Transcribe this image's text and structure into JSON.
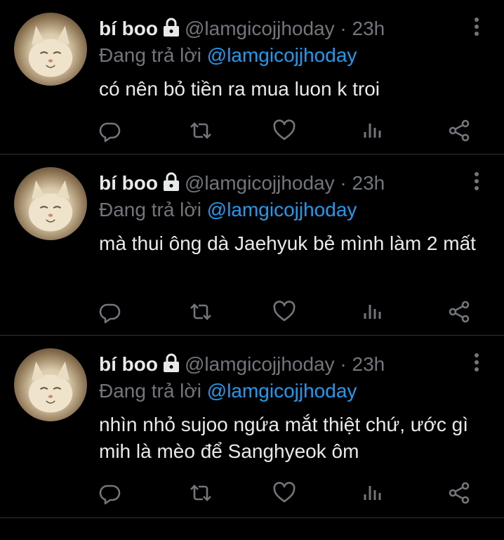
{
  "tweets": [
    {
      "name": "bí boo",
      "handle": "@lamgicojjhoday · 23h",
      "reply_prefix": "Đang trả lời ",
      "reply_to": "@lamgicojjhoday",
      "text": "có nên bỏ tiền ra mua luon k troi"
    },
    {
      "name": "bí boo",
      "handle": "@lamgicojjhoday · 23h",
      "reply_prefix": "Đang trả lời ",
      "reply_to": "@lamgicojjhoday",
      "text": "mà thui ông dà Jaehyuk bẻ mình làm 2 mất"
    },
    {
      "name": "bí boo",
      "handle": "@lamgicojjhoday · 23h",
      "reply_prefix": "Đang trả lời ",
      "reply_to": "@lamgicojjhoday",
      "text": "nhìn nhỏ sujoo ngứa mắt thiệt chứ, ước gì mih là mèo để Sanghyeok ôm"
    }
  ],
  "icons": {
    "reply": "reply-icon",
    "retweet": "retweet-icon",
    "like": "heart-icon",
    "views": "views-icon",
    "share": "share-icon",
    "more": "more-icon",
    "lock": "lock-icon"
  },
  "colors": {
    "background": "#000000",
    "primary_text": "#e7e9ea",
    "secondary_text": "#71767b",
    "accent": "#1d9bf0",
    "divider": "#2f3336"
  }
}
